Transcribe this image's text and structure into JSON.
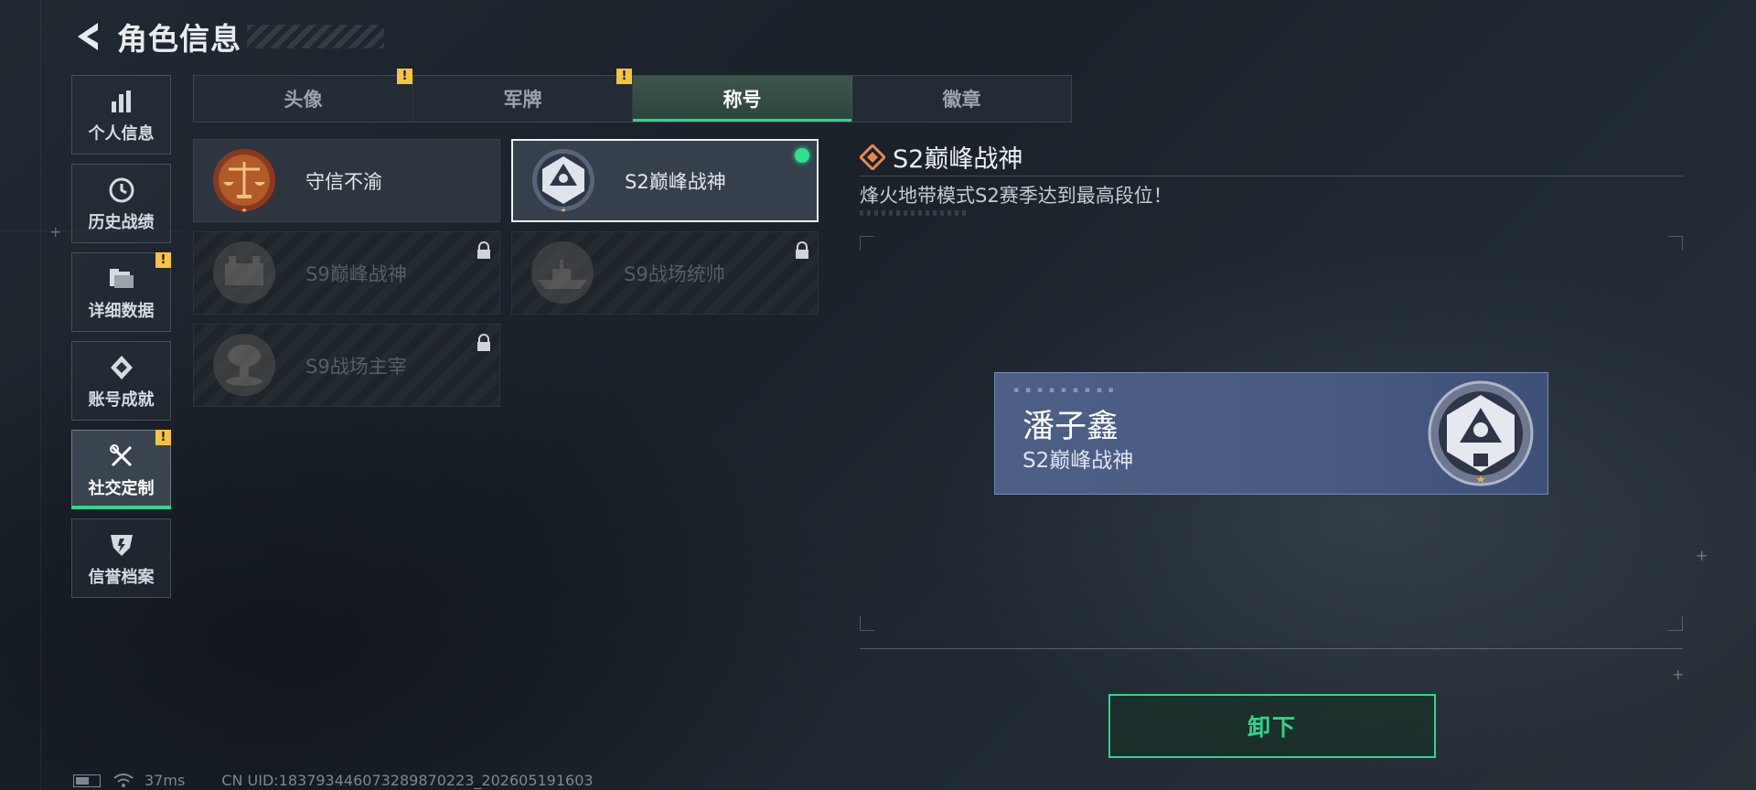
{
  "header": {
    "title": "角色信息"
  },
  "sidebar": {
    "items": [
      {
        "label": "个人信息",
        "icon": "bar-chart-icon",
        "badge": ""
      },
      {
        "label": "历史战绩",
        "icon": "clock-icon",
        "badge": ""
      },
      {
        "label": "详细数据",
        "icon": "folder-icon",
        "badge": "!"
      },
      {
        "label": "账号成就",
        "icon": "achievement-icon",
        "badge": ""
      },
      {
        "label": "社交定制",
        "icon": "tools-icon",
        "badge": "!"
      },
      {
        "label": "信誉档案",
        "icon": "shield-icon",
        "badge": ""
      }
    ],
    "active_index": 4
  },
  "tabs": [
    {
      "label": "头像",
      "badge": "!"
    },
    {
      "label": "军牌",
      "badge": "!"
    },
    {
      "label": "称号",
      "badge": ""
    },
    {
      "label": "徽章",
      "badge": ""
    }
  ],
  "titles": [
    {
      "name": "守信不渝",
      "emblem": "scales-emblem-icon",
      "state": "unlocked"
    },
    {
      "name": "S2巅峰战神",
      "emblem": "peak-god-emblem-icon",
      "state": "selected"
    },
    {
      "name": "S9巅峰战神",
      "emblem": "fortress-emblem-icon",
      "state": "locked"
    },
    {
      "name": "S9战场统帅",
      "emblem": "battleship-emblem-icon",
      "state": "locked"
    },
    {
      "name": "S9战场主宰",
      "emblem": "mushroom-cloud-emblem-icon",
      "state": "locked"
    }
  ],
  "detail": {
    "title": "S2巅峰战神",
    "description": "烽火地带模式S2赛季达到最高段位！"
  },
  "nameplate": {
    "player_name": "潘子鑫",
    "title": "S2巅峰战神"
  },
  "action": {
    "unequip_label": "卸下"
  },
  "status_bar": {
    "ping": "37ms",
    "uid": "CN UID:183793446073289870223_202605191603"
  },
  "colors": {
    "accent_green": "#2fd58a",
    "badge_yellow": "#f5c542",
    "nameplate_blue": "#4e5f86"
  }
}
